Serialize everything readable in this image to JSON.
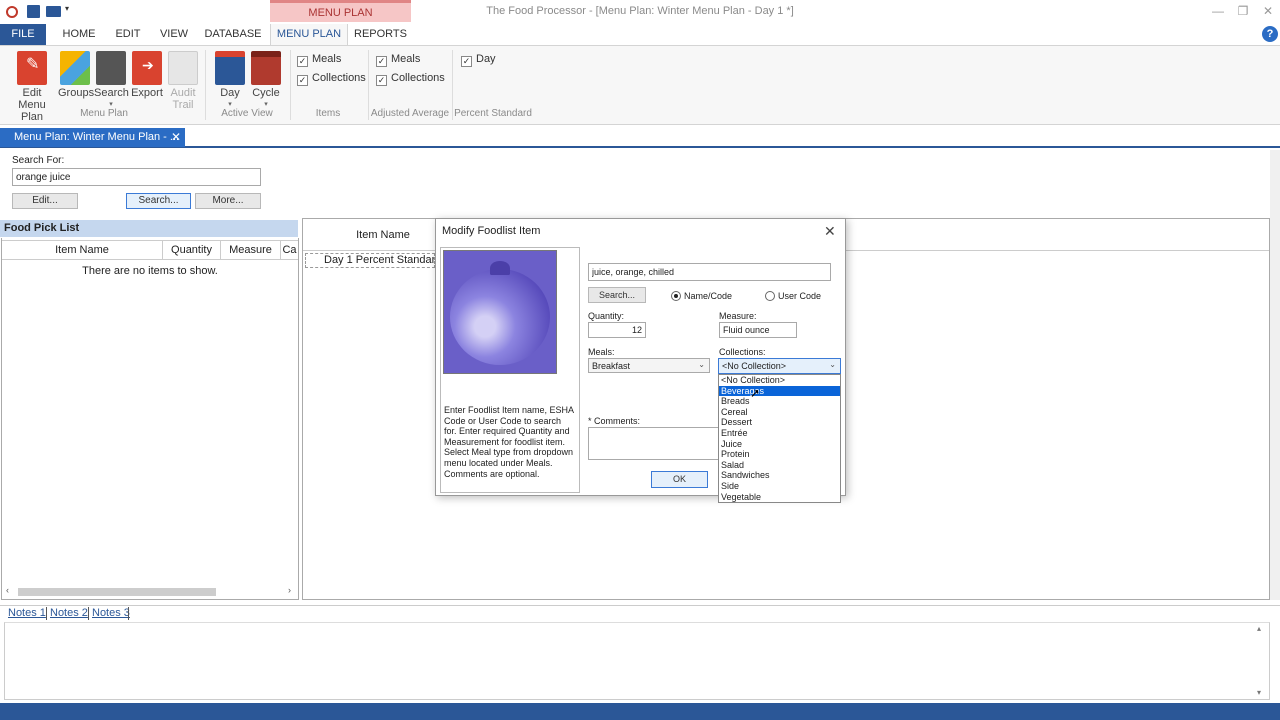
{
  "window": {
    "title": "The Food Processor - [Menu Plan: Winter Menu Plan - Day 1 *]",
    "context_tab_header": "MENU PLAN"
  },
  "ribbon_tabs": [
    "FILE",
    "HOME",
    "EDIT",
    "VIEW",
    "DATABASE",
    "MENU PLAN",
    "REPORTS"
  ],
  "ribbon": {
    "menu_plan_group": {
      "label": "Menu Plan",
      "buttons": [
        "Edit\nMenu Plan",
        "Groups",
        "Search",
        "Export",
        "Audit\nTrail"
      ]
    },
    "active_view_group": {
      "label": "Active View",
      "buttons": [
        "Day",
        "Cycle"
      ]
    },
    "items_group": {
      "label": "Items",
      "checks": [
        "Meals",
        "Collections"
      ]
    },
    "adjusted_group": {
      "label": "Adjusted Average",
      "checks": [
        "Meals",
        "Collections"
      ]
    },
    "percent_group": {
      "label": "Percent Standard",
      "checks": [
        "Day"
      ]
    }
  },
  "doc_tab": {
    "label": "Menu Plan: Winter Menu Plan - ..."
  },
  "search": {
    "label": "Search For:",
    "value": "orange juice",
    "edit_button": "Edit...",
    "search_button": "Search...",
    "more_button": "More..."
  },
  "food_pick_list": {
    "title": "Food Pick List",
    "columns": [
      "Item Name",
      "Quantity",
      "Measure",
      "Ca"
    ],
    "empty_text": "There are no items to show."
  },
  "right_panel": {
    "column_item_name": "Item Name",
    "row_label": "Day 1 Percent Standar"
  },
  "notes_tabs": [
    "Notes 1",
    "Notes 2",
    "Notes 3"
  ],
  "dialog": {
    "title": "Modify Foodlist Item",
    "food_name": "juice, orange, chilled",
    "search_button": "Search...",
    "radio_name_code": "Name/Code",
    "radio_user_code": "User Code",
    "quantity_label": "Quantity:",
    "quantity_value": "12",
    "measure_label": "Measure:",
    "measure_value": "Fluid ounce",
    "meals_label": "Meals:",
    "meals_value": "Breakfast",
    "collections_label": "Collections:",
    "collections_value": "<No Collection>",
    "comments_label": "* Comments:",
    "ok_button": "OK",
    "help_text": "Enter Foodlist Item name, ESHA Code or User Code to search for. Enter required Quantity and Measurement for foodlist item. Select Meal type from dropdown menu located under Meals. Comments are optional.",
    "collections_options": [
      "<No Collection>",
      "Beverages",
      "Breads",
      "Cereal",
      "Dessert",
      "Entrée",
      "Juice",
      "Protein",
      "Salad",
      "Sandwiches",
      "Side",
      "Vegetable"
    ],
    "collections_highlighted": "Beverages"
  },
  "colors": {
    "accent": "#2b5797",
    "header_blue": "#c5d7ee",
    "context_tab": "#f6c6c6",
    "selection": "#0a64d8"
  }
}
